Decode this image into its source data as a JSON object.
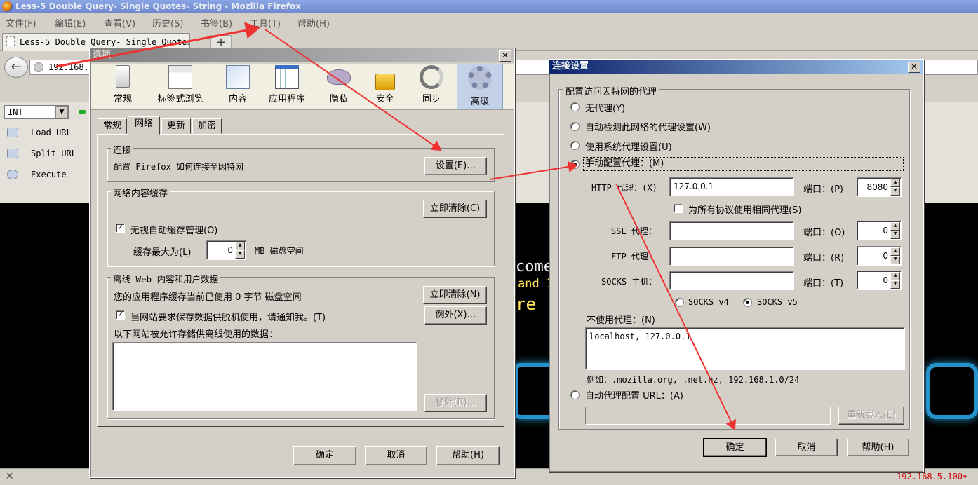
{
  "browser": {
    "window_title": "Less-5 Double Query- Single Quotes- String - Mozilla Firefox",
    "menu": [
      "文件(F)",
      "编辑(E)",
      "查看(V)",
      "历史(S)",
      "书签(B)",
      "工具(T)",
      "帮助(H)"
    ],
    "tab_title": "Less-5 Double Query- Single Quotes-",
    "new_tab": "+",
    "url": "192.168.",
    "status_close": "✕",
    "status_ip": "192.168.5.100▾"
  },
  "hackbar": {
    "select_value": "INT",
    "items": [
      "Load URL",
      "Split URL",
      "Execute"
    ]
  },
  "webpage": {
    "welcome_fragment": "come",
    "and_fragment": "and I",
    "are_fragment": "re"
  },
  "options_dialog": {
    "title": "选项",
    "toolbar": [
      "常规",
      "标签式浏览",
      "内容",
      "应用程序",
      "隐私",
      "安全",
      "同步",
      "高级"
    ],
    "tabs": [
      "常规",
      "网络",
      "更新",
      "加密"
    ],
    "connection": {
      "title": "连接",
      "desc": "配置 Firefox 如何连接至因特网",
      "settings_button": "设置(E)…"
    },
    "cache": {
      "title": "网络内容缓存",
      "clear_button": "立即清除(C)",
      "override_label": "无视自动缓存管理(O)",
      "override_checked": true,
      "limit_label": "缓存最大为(L)",
      "limit_value": "0",
      "limit_unit": "MB 磁盘空间"
    },
    "offline": {
      "title": "离线 Web 内容和用户数据",
      "usage": "您的应用程序缓存当前已使用 0 字节 磁盘空间",
      "clear_button": "立即清除(N)",
      "notify_label": "当网站要求保存数据供脱机使用，请通知我。(T)",
      "notify_checked": true,
      "exceptions_button": "例外(X)…",
      "list_label": "以下网站被允许存储供离线使用的数据：",
      "remove_button": "移除(R)…"
    },
    "buttons": {
      "ok": "确定",
      "cancel": "取消",
      "help": "帮助(H)"
    }
  },
  "connection_dialog": {
    "title": "连接设置",
    "group_title": "配置访问因特网的代理",
    "radios": {
      "no_proxy": "无代理(Y)",
      "auto_detect": "自动检测此网络的代理设置(W)",
      "system": "使用系统代理设置(U)",
      "manual": "手动配置代理：(M)",
      "pac": "自动代理配置 URL：(A)"
    },
    "selected": "manual",
    "http_label": "HTTP 代理：(X)",
    "http_host": "127.0.0.1",
    "http_port_label": "端口：(P)",
    "http_port": "8080",
    "same_proxy_label": "为所有协议使用相同代理(S)",
    "same_proxy_checked": false,
    "ssl_label": "SSL 代理：",
    "ssl_host": "",
    "ssl_port_label": "端口：(O)",
    "ssl_port": "0",
    "ftp_label": "FTP 代理：",
    "ftp_host": "",
    "ftp_port_label": "端口：(R)",
    "ftp_port": "0",
    "socks_label": "SOCKS 主机：",
    "socks_host": "",
    "socks_port_label": "端口：(T)",
    "socks_port": "0",
    "socks_v4": "SOCKS v4",
    "socks_v5": "SOCKS v5",
    "socks_selected": "v5",
    "no_proxy_label": "不使用代理：(N)",
    "no_proxy_value": "localhost, 127.0.0.1",
    "example": "例如：.mozilla.org, .net.nz, 192.168.1.0/24",
    "pac_url": "",
    "reload_button": "重新载入(E)",
    "buttons": {
      "ok": "确定",
      "cancel": "取消",
      "help": "帮助(H)"
    }
  },
  "colors": {
    "arrow": "#ee3333",
    "titlebar": "#0a246a",
    "titlebar_end": "#a6caf0"
  }
}
